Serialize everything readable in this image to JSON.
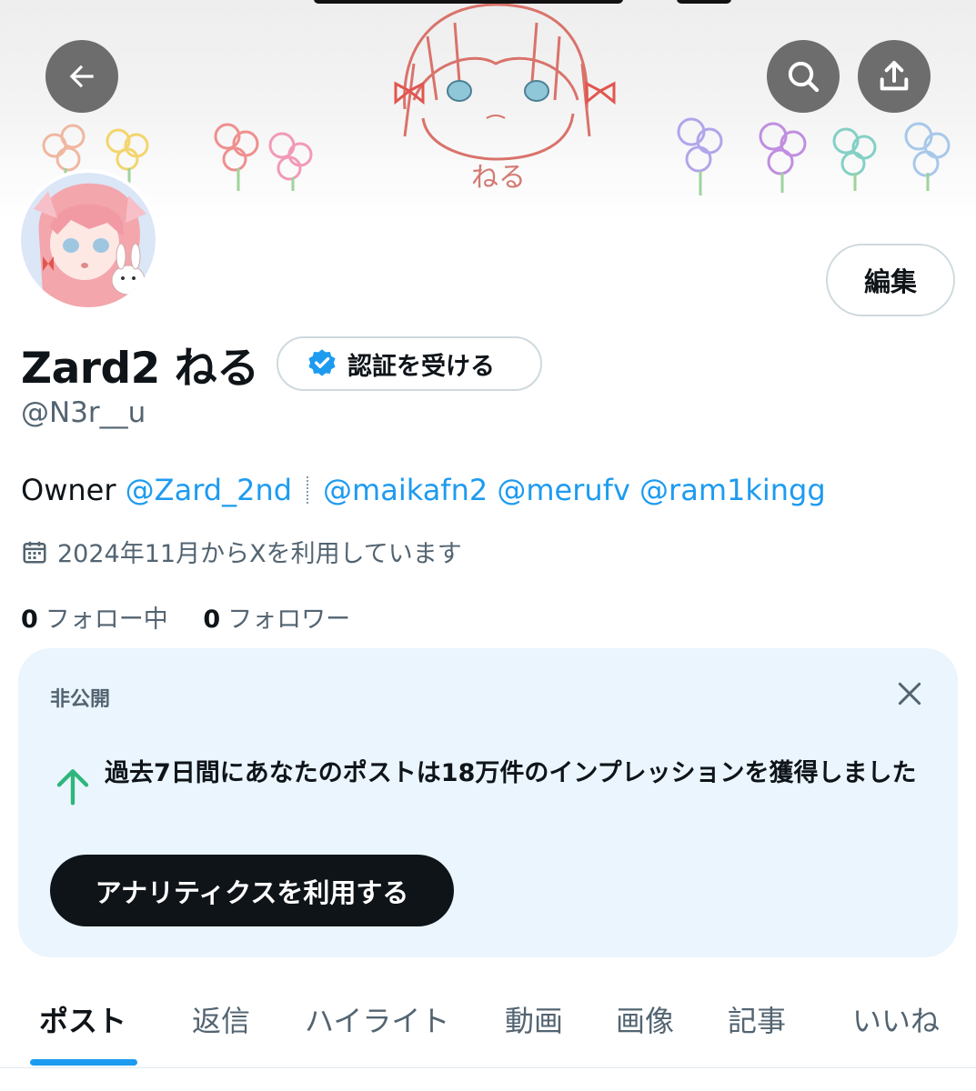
{
  "header": {
    "back_icon": "arrow-left-icon",
    "search_icon": "search-icon",
    "share_icon": "share-upload-icon",
    "banner_caption": "ねる"
  },
  "profile": {
    "display_name": "Zard2 ねる",
    "verify_label": "認証を受ける",
    "handle": "@N3r__u",
    "edit_label": "編集",
    "bio": {
      "prefix": "Owner",
      "mentions": [
        "@Zard_2nd",
        "@maikafn2",
        "@merufv",
        "@ram1kingg"
      ]
    },
    "joined": "2024年11月からXを利用しています",
    "following_count": "0",
    "following_label": "フォロー中",
    "followers_count": "0",
    "followers_label": "フォロワー"
  },
  "analytics_card": {
    "private_label": "非公開",
    "message": "過去7日間にあなたのポストは18万件のインプレッションを獲得しました",
    "cta_label": "アナリティクスを利用する"
  },
  "tabs": [
    {
      "label": "ポスト"
    },
    {
      "label": "返信"
    },
    {
      "label": "ハイライト"
    },
    {
      "label": "動画"
    },
    {
      "label": "画像"
    },
    {
      "label": "記事"
    },
    {
      "label": "いいね"
    }
  ],
  "colors": {
    "accent": "#1d9bf0",
    "text": "#0f1419",
    "secondary": "#536471",
    "card_bg": "#eaf5fd",
    "up_arrow": "#2fb67c"
  }
}
